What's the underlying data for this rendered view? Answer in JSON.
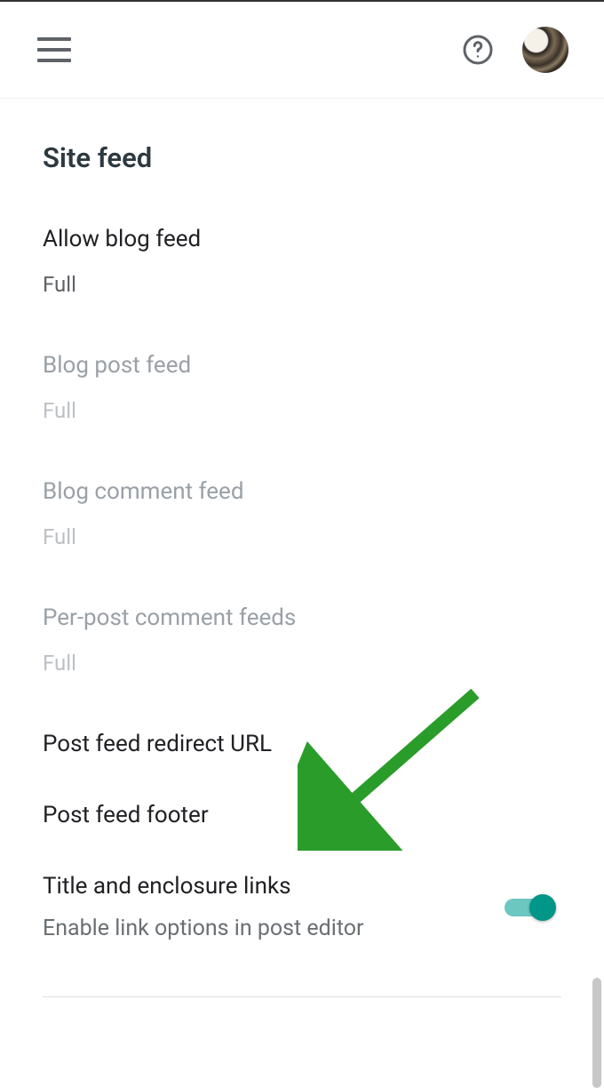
{
  "section": {
    "title": "Site feed"
  },
  "settings": {
    "allow_blog_feed": {
      "label": "Allow blog feed",
      "value": "Full"
    },
    "blog_post_feed": {
      "label": "Blog post feed",
      "value": "Full"
    },
    "blog_comment_feed": {
      "label": "Blog comment feed",
      "value": "Full"
    },
    "per_post_comment_feeds": {
      "label": "Per-post comment feeds",
      "value": "Full"
    },
    "post_feed_redirect_url": {
      "label": "Post feed redirect URL"
    },
    "post_feed_footer": {
      "label": "Post feed footer"
    },
    "title_enclosure": {
      "label": "Title and enclosure links",
      "subtitle": "Enable link options in post editor"
    }
  }
}
